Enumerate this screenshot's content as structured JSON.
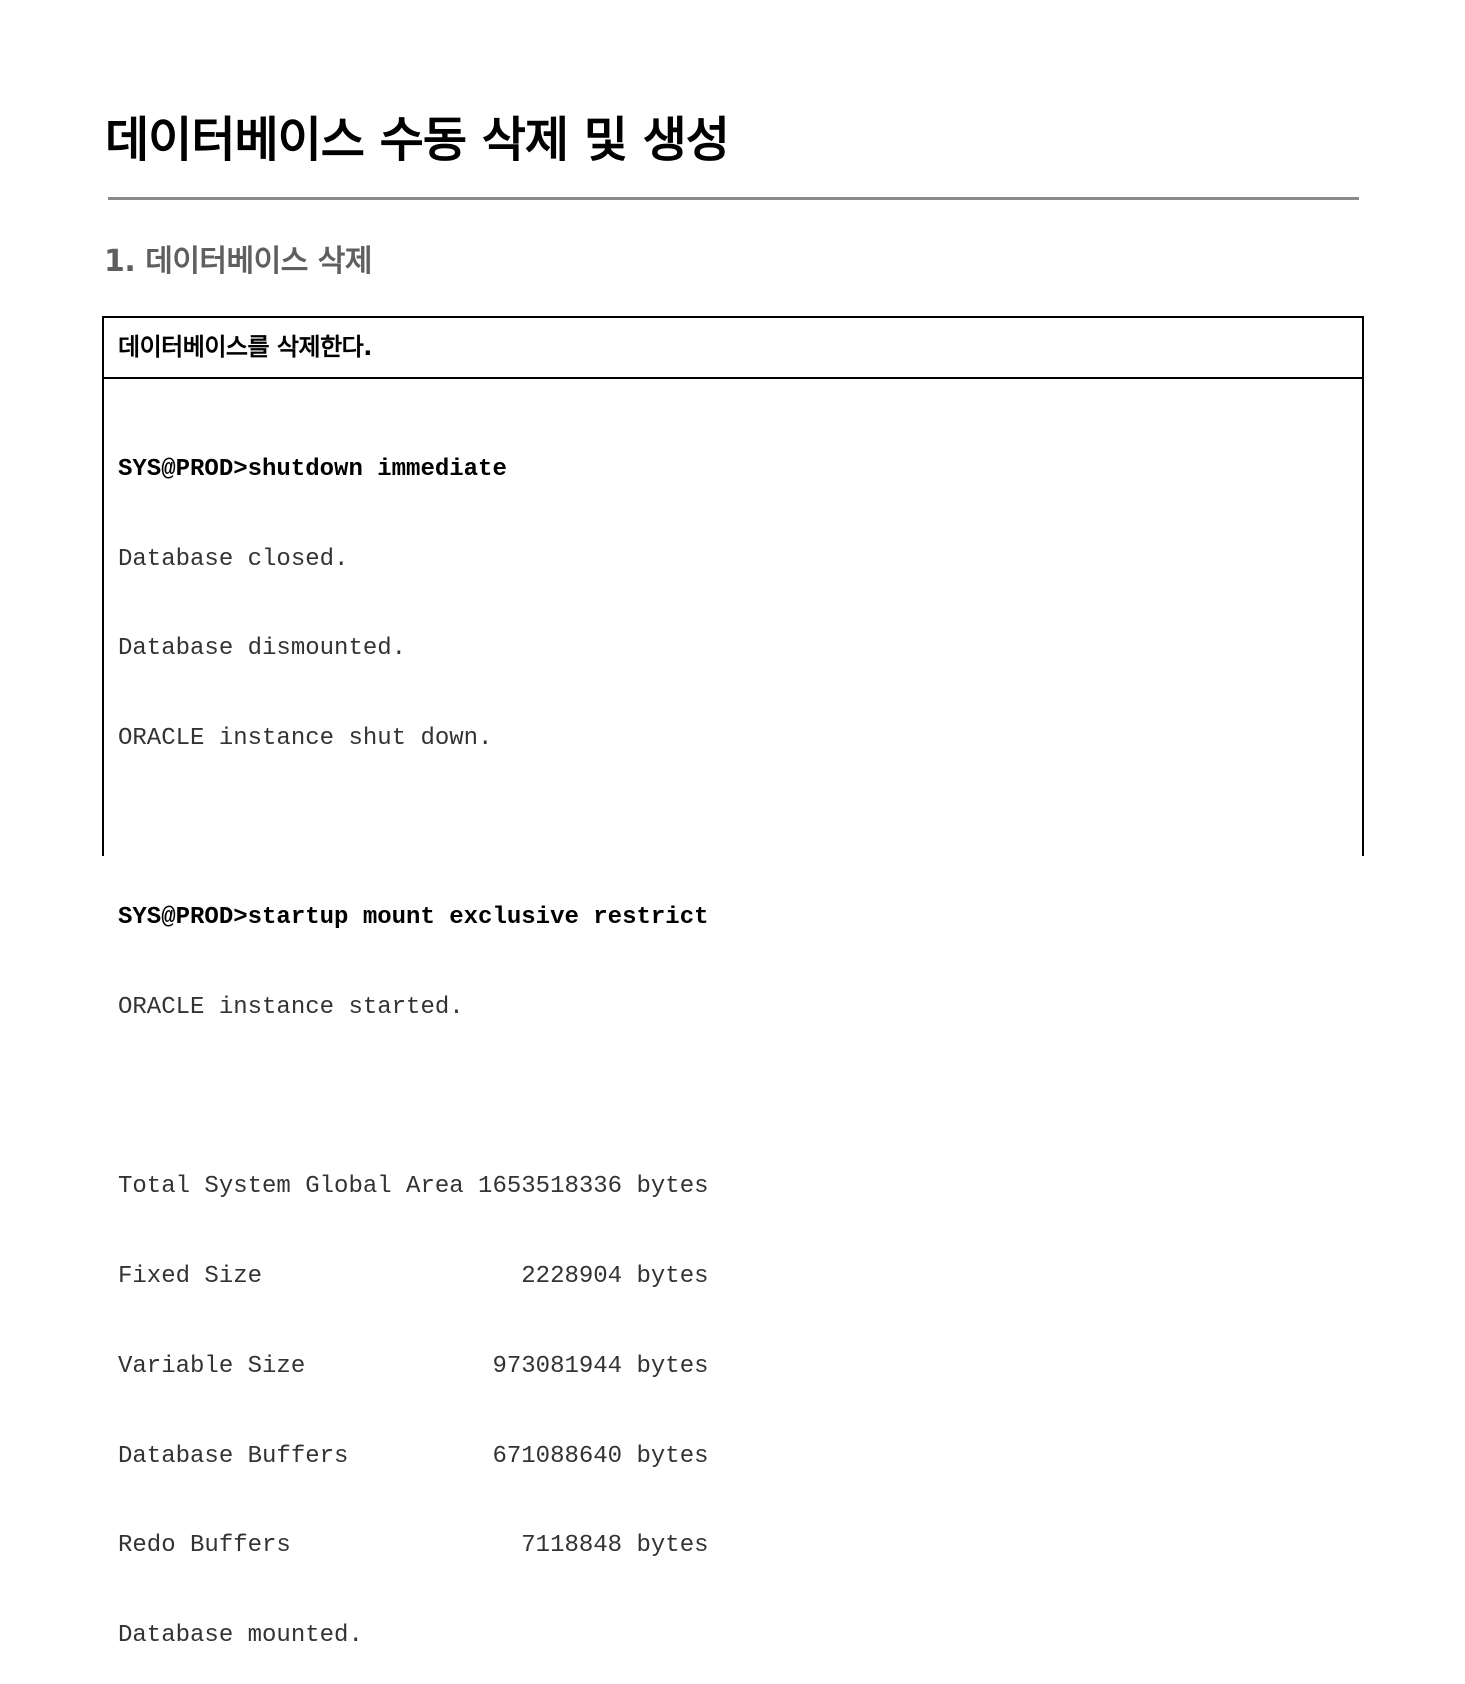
{
  "document": {
    "title": "데이터베이스 수동 삭제 및 생성",
    "section_heading": "1. 데이터베이스 삭제"
  },
  "code_box": {
    "header": "데이터베이스를 삭제한다.",
    "lines": [
      {
        "kind": "cmd",
        "text": "SYS@PROD>shutdown immediate"
      },
      {
        "kind": "out",
        "text": "Database closed."
      },
      {
        "kind": "out",
        "text": "Database dismounted."
      },
      {
        "kind": "out",
        "text": "ORACLE instance shut down."
      },
      {
        "kind": "blank",
        "text": ""
      },
      {
        "kind": "cmd",
        "text": "SYS@PROD>startup mount exclusive restrict"
      },
      {
        "kind": "out",
        "text": "ORACLE instance started."
      },
      {
        "kind": "blank",
        "text": ""
      },
      {
        "kind": "out",
        "text": "Total System Global Area 1653518336 bytes"
      },
      {
        "kind": "out",
        "text": "Fixed Size                  2228904 bytes"
      },
      {
        "kind": "out",
        "text": "Variable Size             973081944 bytes"
      },
      {
        "kind": "out",
        "text": "Database Buffers          671088640 bytes"
      },
      {
        "kind": "out",
        "text": "Redo Buffers                7118848 bytes"
      },
      {
        "kind": "out",
        "text": "Database mounted."
      }
    ]
  }
}
